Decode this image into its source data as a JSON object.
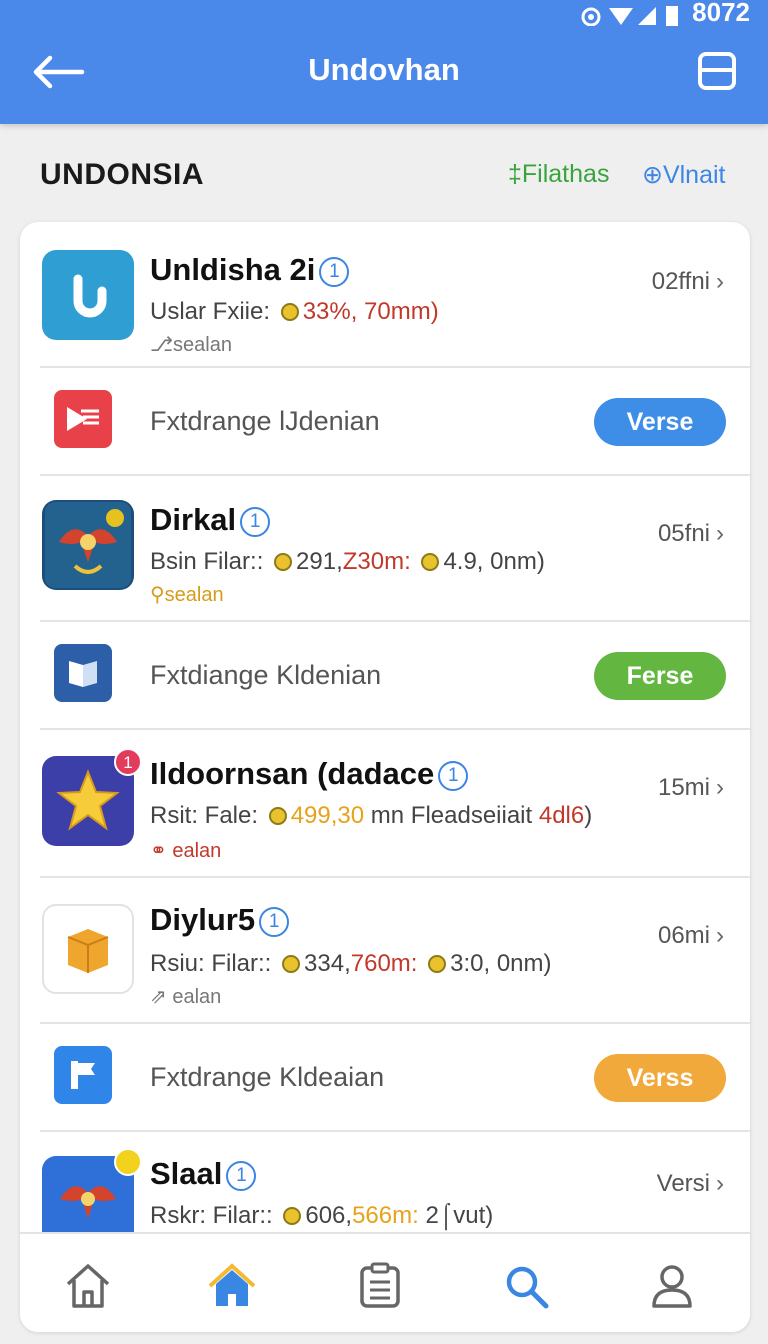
{
  "status": {
    "time": "8072"
  },
  "header": {
    "title": "Undovhan"
  },
  "section": {
    "title": "UNDONSIA",
    "link_a": "‡Filathas",
    "link_b": "⊕Vlnait"
  },
  "colors": {
    "appbar": "#4a88ea",
    "pill_blue": "#3e8ee8",
    "pill_green": "#63b63f",
    "pill_orange": "#f2a93b"
  },
  "items": [
    {
      "type": "app",
      "icon": "blue-u-app-icon",
      "name": "Unldisha 2i",
      "distance": "02ffni",
      "meta_prefix": "Uslar Fxiie:",
      "meta_red": "33%, 70mm)",
      "meta_after": "",
      "meta_yellow": "",
      "meta_tail": "",
      "sub": "⎇sealan"
    },
    {
      "type": "promo",
      "icon": "red-document-icon",
      "text": "Fxtdrange lJdenian",
      "button": "Verse",
      "button_color": "blue"
    },
    {
      "type": "app",
      "icon": "garuda-emblem-icon",
      "name": "Dirkal",
      "distance": "05fni",
      "meta_prefix": "Bsin Filar::",
      "meta_plain": "291,",
      "meta_red": "Z30m:",
      "meta_after": "4.9, 0nm)",
      "sub": "sealan"
    },
    {
      "type": "promo",
      "icon": "blue-flag-icon",
      "text": "Fxtdiange Kldenian",
      "button": "Ferse",
      "button_color": "green"
    },
    {
      "type": "app",
      "icon": "star-icon",
      "badge": "1",
      "name": "Ildoornsan (dadace",
      "distance": "15mi",
      "meta_prefix": "Rsit: Fale:",
      "meta_yellow": "499,30",
      "meta_after": "mn Fleadseiiait",
      "meta_red": "4dl6",
      "meta_tail": ")",
      "sub": "ealan"
    },
    {
      "type": "app",
      "icon": "package-icon",
      "name": "Diylur5",
      "distance": "06mi",
      "meta_prefix": "Rsiu: Filar::",
      "meta_plain": "334,",
      "meta_red": "760m:",
      "meta_after": "3:0, 0nm)",
      "sub": "ealan"
    },
    {
      "type": "promo",
      "icon": "blue-f-app-icon",
      "text": "Fxtdrange Kldeaian",
      "button": "Verss",
      "button_color": "orange"
    },
    {
      "type": "app",
      "icon": "garuda-blue-icon",
      "name": "Slaal",
      "distance": "Versi",
      "meta_prefix": "Rskr: Filar::",
      "meta_plain": "606,",
      "meta_yellow": "566m:",
      "meta_after": "2⌠vut)"
    }
  ],
  "nav": [
    {
      "icon": "home-outline-icon"
    },
    {
      "icon": "home-filled-icon"
    },
    {
      "icon": "clipboard-icon"
    },
    {
      "icon": "search-icon"
    },
    {
      "icon": "profile-icon"
    }
  ]
}
